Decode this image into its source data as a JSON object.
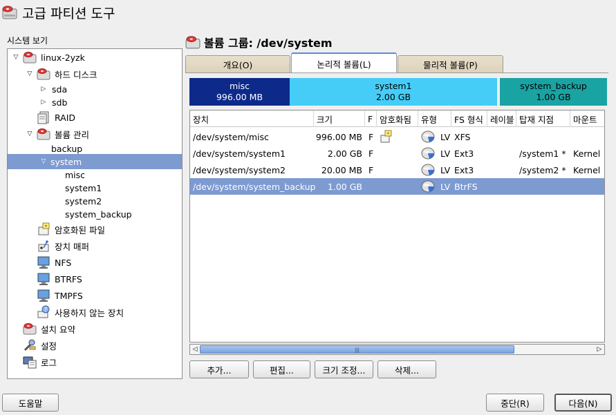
{
  "window": {
    "title": "고급 파티션 도구"
  },
  "sidebar": {
    "heading": "시스템 보기",
    "tree": [
      {
        "label": "linux-2yzk"
      },
      {
        "label": "하드 디스크"
      },
      {
        "label": "sda"
      },
      {
        "label": "sdb"
      },
      {
        "label": "RAID"
      },
      {
        "label": "볼륨 관리"
      },
      {
        "label": "backup"
      },
      {
        "label": "system"
      },
      {
        "label": "misc"
      },
      {
        "label": "system1"
      },
      {
        "label": "system2"
      },
      {
        "label": "system_backup"
      },
      {
        "label": "암호화된 파일"
      },
      {
        "label": "장치 매퍼"
      },
      {
        "label": "NFS"
      },
      {
        "label": "BTRFS"
      },
      {
        "label": "TMPFS"
      },
      {
        "label": "사용하지 않는 장치"
      },
      {
        "label": "설치 요약"
      },
      {
        "label": "설정"
      },
      {
        "label": "로그"
      }
    ]
  },
  "main": {
    "title": "볼륨 그룹: /dev/system",
    "tabs": [
      {
        "label": "개요(O)"
      },
      {
        "label": "논리적 볼륨(L)"
      },
      {
        "label": "물리적 볼륨(P)"
      }
    ],
    "volume_bar": [
      {
        "name": "misc",
        "size": "996.00 MB",
        "color": "#0d2a8a",
        "text_color": "#ffffff"
      },
      {
        "name": "system1",
        "size": "2.00 GB",
        "color": "#45cdf7",
        "text_color": "#000000"
      },
      {
        "name": "system_backup",
        "size": "1.00 GB",
        "color": "#1aa3a3",
        "text_color": "#000000"
      }
    ],
    "table": {
      "columns": [
        "장치",
        "크기",
        "F",
        "암호화됨",
        "유형",
        "FS 형식",
        "레이블",
        "탑재 지점",
        "마운트"
      ],
      "rows": [
        {
          "device": "/dev/system/misc",
          "size": "996.00 MB",
          "f": "F",
          "encrypted": true,
          "type": "LV",
          "fs": "XFS",
          "label": "",
          "mount": "",
          "mount_by": ""
        },
        {
          "device": "/dev/system/system1",
          "size": "2.00 GB",
          "f": "F",
          "encrypted": false,
          "type": "LV",
          "fs": "Ext3",
          "label": "",
          "mount": "/system1 *",
          "mount_by": "Kernel"
        },
        {
          "device": "/dev/system/system2",
          "size": "20.00 MB",
          "f": "F",
          "encrypted": false,
          "type": "LV",
          "fs": "Ext3",
          "label": "",
          "mount": "/system2 *",
          "mount_by": "Kernel"
        },
        {
          "device": "/dev/system/system_backup",
          "size": "1.00 GB",
          "f": "",
          "encrypted": false,
          "type": "LV",
          "fs": "BtrFS",
          "label": "",
          "mount": "",
          "mount_by": ""
        }
      ]
    },
    "buttons": {
      "add": "추가...",
      "edit": "편집...",
      "resize": "크기 조정...",
      "delete": "삭제..."
    }
  },
  "footer": {
    "help": "도움말",
    "abort": "중단(R)",
    "next": "다음(N)"
  }
}
